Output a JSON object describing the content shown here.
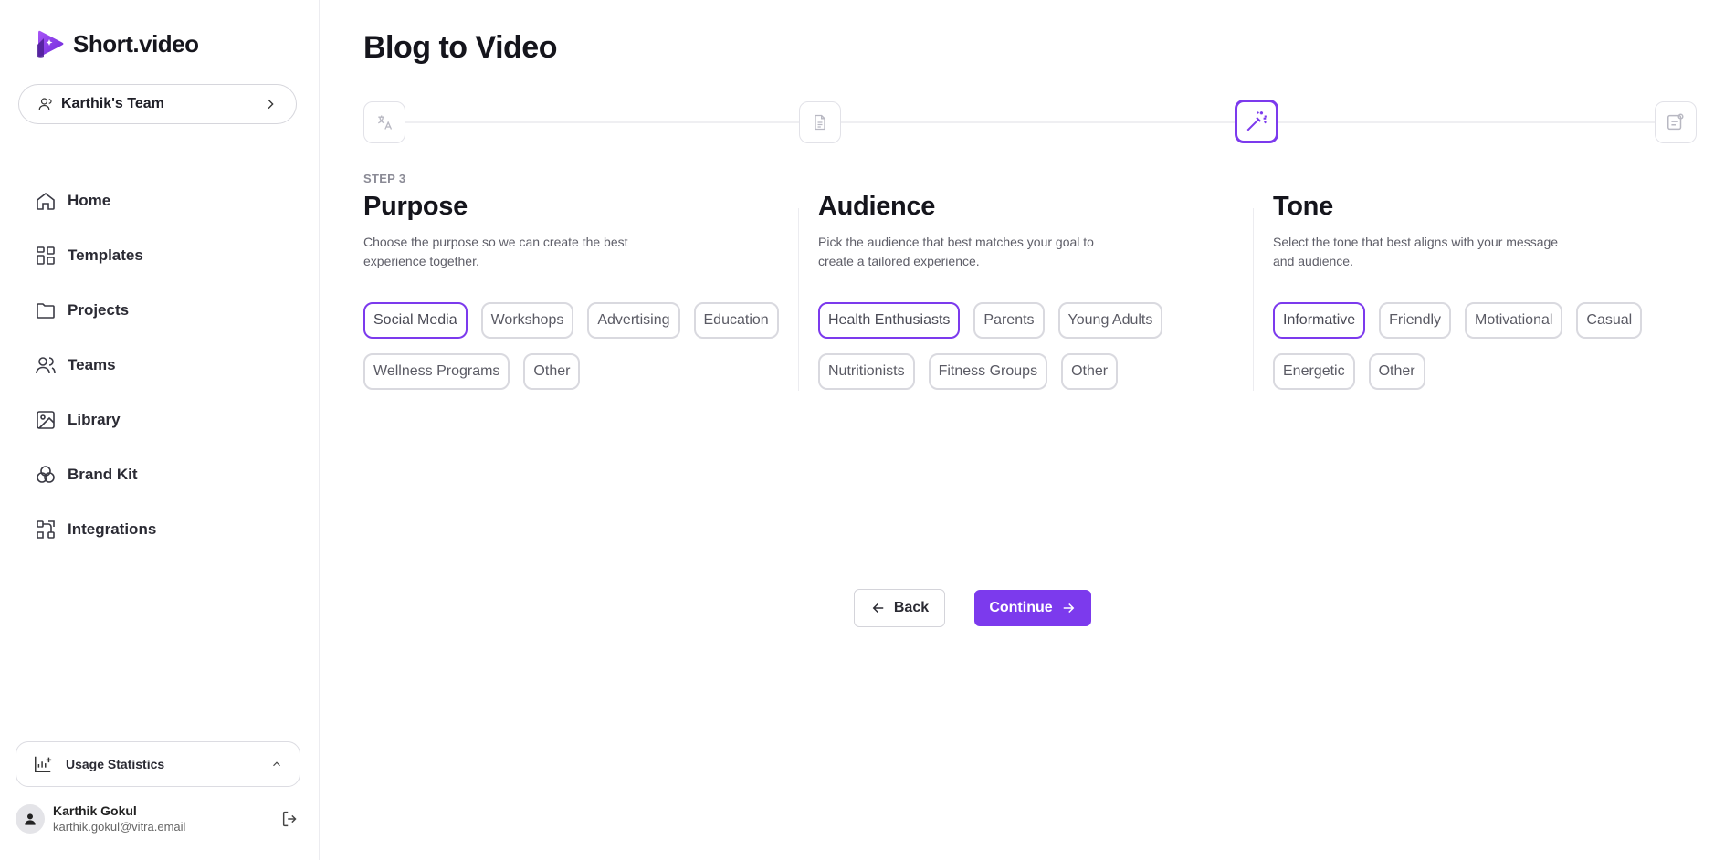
{
  "app": {
    "name": "Short.video"
  },
  "team": {
    "label": "Karthik's Team"
  },
  "nav": [
    {
      "label": "Home",
      "icon": "home-icon"
    },
    {
      "label": "Templates",
      "icon": "templates-icon"
    },
    {
      "label": "Projects",
      "icon": "folder-icon"
    },
    {
      "label": "Teams",
      "icon": "users-icon"
    },
    {
      "label": "Library",
      "icon": "image-icon"
    },
    {
      "label": "Brand Kit",
      "icon": "brand-kit-icon"
    },
    {
      "label": "Integrations",
      "icon": "integrations-icon"
    }
  ],
  "usage": {
    "label": "Usage Statistics"
  },
  "user": {
    "name": "Karthik Gokul",
    "email": "karthik.gokul@vitra.email"
  },
  "page": {
    "title": "Blog to Video",
    "step_label": "STEP 3"
  },
  "stepper": {
    "steps": [
      {
        "icon": "translate-icon",
        "state": "done"
      },
      {
        "icon": "document-icon",
        "state": "done"
      },
      {
        "icon": "magic-wand-icon",
        "state": "active"
      },
      {
        "icon": "preview-icon",
        "state": "pending"
      }
    ],
    "accent": "#7c3aed"
  },
  "sections": {
    "purpose": {
      "title": "Purpose",
      "description": "Choose the purpose so we can create the best experience together.",
      "options": [
        "Social Media",
        "Workshops",
        "Advertising",
        "Education",
        "Wellness Programs",
        "Other"
      ],
      "selected": "Social Media"
    },
    "audience": {
      "title": "Audience",
      "description": "Pick the audience that best matches your goal to create a tailored experience.",
      "options": [
        "Health Enthusiasts",
        "Parents",
        "Young Adults",
        "Nutritionists",
        "Fitness Groups",
        "Other"
      ],
      "selected": "Health Enthusiasts"
    },
    "tone": {
      "title": "Tone",
      "description": "Select the tone that best aligns with your message and audience.",
      "options": [
        "Informative",
        "Friendly",
        "Motivational",
        "Casual",
        "Energetic",
        "Other"
      ],
      "selected": "Informative"
    }
  },
  "actions": {
    "back": "Back",
    "continue": "Continue"
  }
}
